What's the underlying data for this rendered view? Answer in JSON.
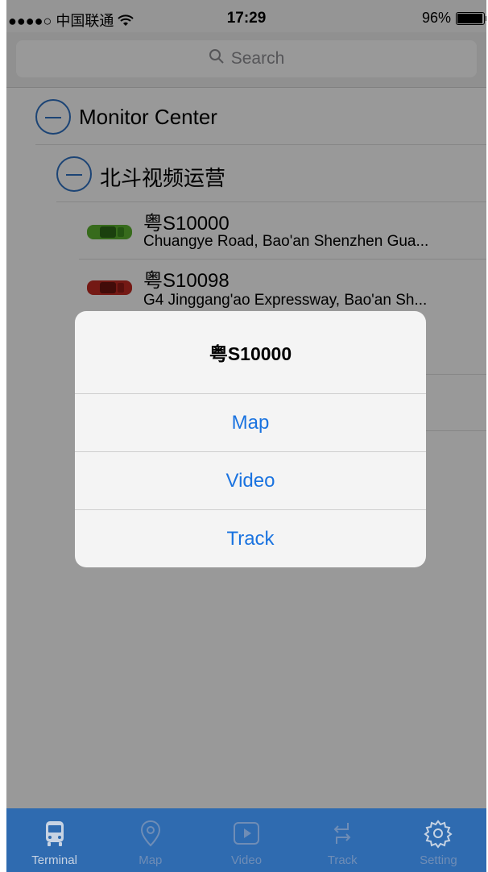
{
  "status_bar": {
    "carrier": "●●●●○ 中国联通",
    "time": "17:29",
    "battery": "96%"
  },
  "search": {
    "placeholder": "Search"
  },
  "tree": {
    "root_label": "Monitor Center",
    "group_label": "北斗视频运营",
    "vehicles": [
      {
        "plate": "粤S10000",
        "address": "Chuangye Road, Bao'an Shenzhen Gua...",
        "color": "#5cb32f"
      },
      {
        "plate": "粤S10098",
        "address": "G4 Jinggang'ao Expressway, Bao'an Sh...",
        "color": "#c22a22"
      }
    ]
  },
  "dialog": {
    "title": "粤S10000",
    "actions": [
      "Map",
      "Video",
      "Track"
    ]
  },
  "tabbar": {
    "items": [
      {
        "label": "Terminal",
        "icon": "bus-icon",
        "active": true
      },
      {
        "label": "Map",
        "icon": "map-pin-icon",
        "active": false
      },
      {
        "label": "Video",
        "icon": "play-icon",
        "active": false
      },
      {
        "label": "Track",
        "icon": "track-arrows-icon",
        "active": false
      },
      {
        "label": "Setting",
        "icon": "gear-icon",
        "active": false
      }
    ]
  },
  "colors": {
    "accent": "#2f72c4",
    "tabbar_bg": "#2f6bb0",
    "link": "#1a73e0"
  }
}
